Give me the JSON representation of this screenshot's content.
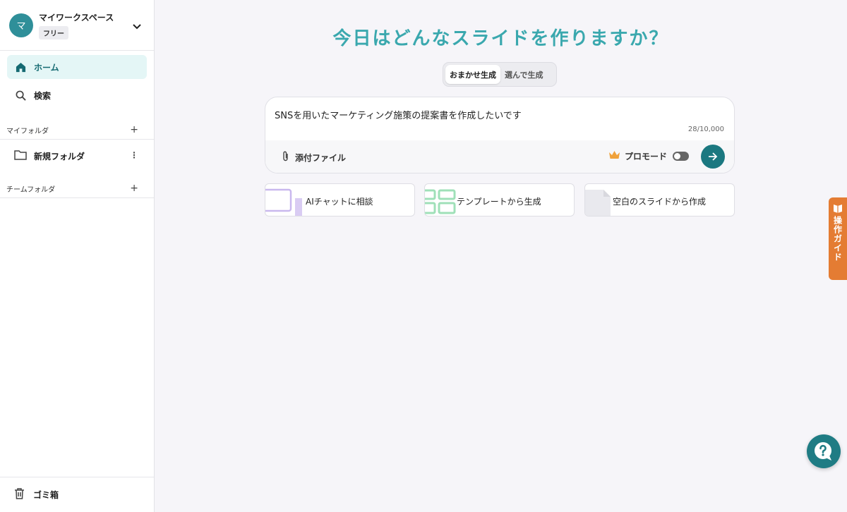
{
  "workspace": {
    "avatar_letter": "マ",
    "name": "マイワークスペース",
    "plan": "フリー"
  },
  "nav": [
    {
      "label": "ホーム",
      "icon": "home-icon",
      "active": true
    },
    {
      "label": "検索",
      "icon": "search-icon",
      "active": false
    }
  ],
  "my_folders": {
    "title": "マイフォルダ",
    "add": "+",
    "items": [
      {
        "name": "新規フォルダ"
      }
    ]
  },
  "team_folders": {
    "title": "チームフォルダ",
    "add": "+"
  },
  "trash": {
    "label": "ゴミ箱"
  },
  "main": {
    "headline": "今日はどんなスライドを作りますか？",
    "modes": [
      {
        "label": "おまかせ生成",
        "active": true
      },
      {
        "label": "選んで生成",
        "active": false
      }
    ],
    "prompt": {
      "value": "SNSを用いたマーケティング施策の提案書を作成したいです",
      "counter": "28/10,000",
      "attach_label": "添付ファイル",
      "pro_mode_label": "プロモード",
      "pro_mode_on": false
    },
    "cards": [
      {
        "label": "AIチャットに相談"
      },
      {
        "label": "テンプレートから生成"
      },
      {
        "label": "空白のスライドから作成"
      }
    ]
  },
  "guide_tab": {
    "label": "操作ガイド"
  },
  "colors": {
    "accent": "#1b7880",
    "headline": "#3aa8ae",
    "guide": "#e47c33",
    "avatar": "#2f8f99"
  }
}
